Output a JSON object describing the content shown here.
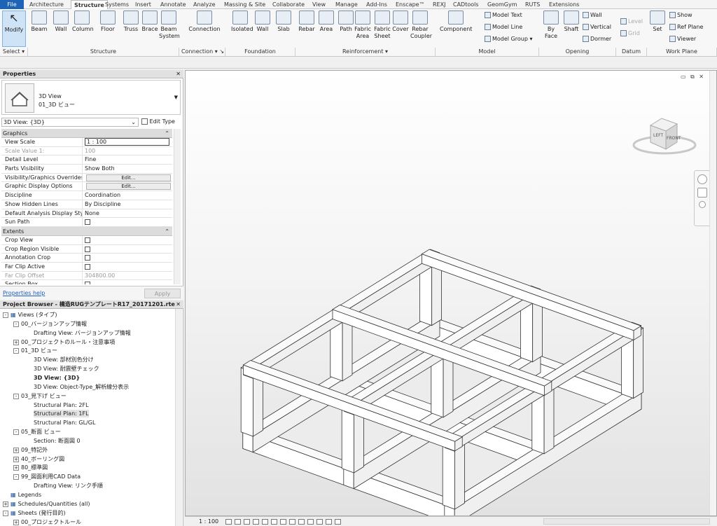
{
  "menu": {
    "file": "File",
    "tabs": [
      "Architecture",
      "Structure",
      "Systems",
      "Insert",
      "Annotate",
      "Analyze",
      "Massing & Site",
      "Collaborate",
      "View",
      "Manage",
      "Add-Ins",
      "Enscape™",
      "REXJ",
      "CADtools",
      "GeomGym",
      "RUTS",
      "Extensions"
    ],
    "active_tab": "Structure"
  },
  "ribbon": {
    "modify": "Modify",
    "select": "Select ▾",
    "structure_buttons": [
      "Beam",
      "Wall",
      "Column",
      "Floor",
      "Truss",
      "Brace",
      "Beam System"
    ],
    "connection": "Connection",
    "foundation_buttons": [
      "Isolated",
      "Wall",
      "Slab"
    ],
    "reinforcement_buttons": [
      "Rebar",
      "Area",
      "Path",
      "Fabric Area",
      "Fabric Sheet",
      "Cover",
      "Rebar Coupler"
    ],
    "component": "Component",
    "model_small": [
      "Model Text",
      "Model Line",
      "Model Group ▾"
    ],
    "opening_buttons": [
      "By Face",
      "Shaft"
    ],
    "opening_small": [
      "Wall",
      "Vertical",
      "Dormer"
    ],
    "datum_small": [
      "Level",
      "Grid"
    ],
    "set": "Set",
    "workplane_small": [
      "Show",
      "Ref Plane",
      "Viewer"
    ],
    "groups": [
      "Select ▾",
      "Structure",
      "Connection ▾ ↘",
      "Foundation",
      "Reinforcement ▾",
      "Model",
      "Opening",
      "Datum",
      "Work Plane"
    ]
  },
  "properties": {
    "title": "Properties",
    "type_name": "3D View",
    "type_sub": "01_3D ビュー",
    "selector": "3D View: {3D}",
    "edit_type": "Edit Type",
    "graphics_label": "Graphics",
    "rows_graphics": [
      {
        "k": "View Scale",
        "v": "1 : 100",
        "kind": "input"
      },
      {
        "k": "Scale Value    1:",
        "v": "100",
        "kind": "dim"
      },
      {
        "k": "Detail Level",
        "v": "Fine"
      },
      {
        "k": "Parts Visibility",
        "v": "Show Both"
      },
      {
        "k": "Visibility/Graphics Overrides",
        "v": "Edit...",
        "kind": "button"
      },
      {
        "k": "Graphic Display Options",
        "v": "Edit...",
        "kind": "button"
      },
      {
        "k": "Discipline",
        "v": "Coordination"
      },
      {
        "k": "Show Hidden Lines",
        "v": "By Discipline"
      },
      {
        "k": "Default Analysis Display Style",
        "v": "None"
      },
      {
        "k": "Sun Path",
        "v": "",
        "kind": "check"
      }
    ],
    "extents_label": "Extents",
    "rows_extents": [
      {
        "k": "Crop View",
        "v": "",
        "kind": "check"
      },
      {
        "k": "Crop Region Visible",
        "v": "",
        "kind": "check"
      },
      {
        "k": "Annotation Crop",
        "v": "",
        "kind": "check"
      },
      {
        "k": "Far Clip Active",
        "v": "",
        "kind": "check"
      },
      {
        "k": "Far Clip Offset",
        "v": "304800.00",
        "kind": "dim"
      },
      {
        "k": "Section Box",
        "v": "",
        "kind": "check"
      }
    ],
    "help_link": "Properties help",
    "apply": "Apply"
  },
  "browser": {
    "title": "Project Browser - 構造RUGテンプレートR17_20171201.rte",
    "nodes": [
      {
        "t": "Views (タイプ)",
        "lvl": 0,
        "pm": "-",
        "icon": "views"
      },
      {
        "t": "00_バージョンアップ情報",
        "lvl": 1,
        "pm": "-"
      },
      {
        "t": "Drafting View: バージョンアップ情報",
        "lvl": 2
      },
      {
        "t": "00_プロジェクトのルール・注意事項",
        "lvl": 1,
        "pm": "+"
      },
      {
        "t": "01_3D ビュー",
        "lvl": 1,
        "pm": "-"
      },
      {
        "t": "3D View: 部材別色分け",
        "lvl": 2
      },
      {
        "t": "3D View: 耐震壁チェック",
        "lvl": 2
      },
      {
        "t": "3D View: {3D}",
        "lvl": 2,
        "bold": true
      },
      {
        "t": "3D View: Object-Type_解析線分表示",
        "lvl": 2
      },
      {
        "t": "03_見下げ ビュー",
        "lvl": 1,
        "pm": "-"
      },
      {
        "t": "Structural Plan: 2FL",
        "lvl": 2
      },
      {
        "t": "Structural Plan: 1FL",
        "lvl": 2,
        "hl": true
      },
      {
        "t": "Structural Plan: GL/GL",
        "lvl": 2
      },
      {
        "t": "05_断面 ビュー",
        "lvl": 1,
        "pm": "-"
      },
      {
        "t": "Section: 断面図 0",
        "lvl": 2
      },
      {
        "t": "09_特記外",
        "lvl": 1,
        "pm": "+"
      },
      {
        "t": "40_ボーリング図",
        "lvl": 1,
        "pm": "+"
      },
      {
        "t": "80_標準図",
        "lvl": 1,
        "pm": "+"
      },
      {
        "t": "99_図面利用CAD Data",
        "lvl": 1,
        "pm": "-"
      },
      {
        "t": "Drafting View: リンク手順",
        "lvl": 2
      },
      {
        "t": "Legends",
        "lvl": 0,
        "icon": "legend"
      },
      {
        "t": "Schedules/Quantities (all)",
        "lvl": 0,
        "pm": "+",
        "icon": "schedule"
      },
      {
        "t": "Sheets (発行目的)",
        "lvl": 0,
        "pm": "-",
        "icon": "sheet"
      },
      {
        "t": "00_プロジェクトルール",
        "lvl": 1,
        "pm": "+"
      }
    ]
  },
  "viewport": {
    "cube_left": "LEFT",
    "cube_front": "FRONT",
    "scale": "1 : 100"
  }
}
